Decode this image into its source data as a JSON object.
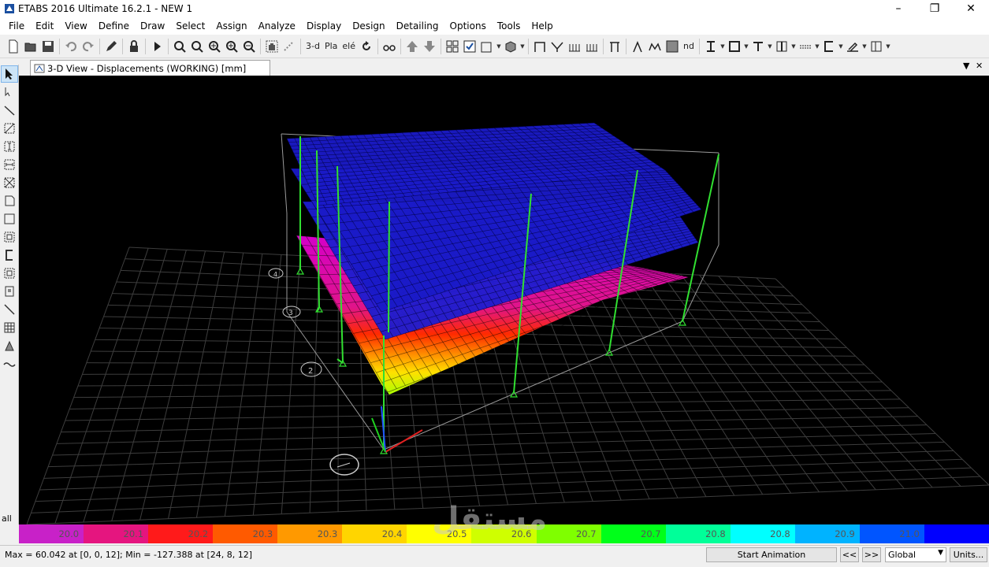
{
  "window": {
    "title": "ETABS 2016 Ultimate 16.2.1 - NEW 1",
    "minimize": "–",
    "maximize": "❐",
    "close": "✕"
  },
  "menu": [
    "File",
    "Edit",
    "View",
    "Define",
    "Draw",
    "Select",
    "Assign",
    "Analyze",
    "Display",
    "Design",
    "Detailing",
    "Options",
    "Tools",
    "Help"
  ],
  "toolbar": {
    "view_3d_label": "3-d",
    "plan_label": "Pla",
    "elev_label": "elé",
    "nd_label": "nd"
  },
  "tab": {
    "label": "3-D View   - Displacements (WORKING)  [mm]",
    "dropdown": "▼",
    "close": "✕"
  },
  "left_tools": {
    "all_label": "all"
  },
  "colorbar": {
    "segments": [
      {
        "label": "20.0",
        "color": "#c821c8"
      },
      {
        "label": "20.1",
        "color": "#e5157f"
      },
      {
        "label": "20.2",
        "color": "#ff1a1a"
      },
      {
        "label": "20.3",
        "color": "#ff5a00"
      },
      {
        "label": "20.3",
        "color": "#ff9900"
      },
      {
        "label": "20.4",
        "color": "#ffd500"
      },
      {
        "label": "20.5",
        "color": "#ffff00"
      },
      {
        "label": "20.6",
        "color": "#cfff00"
      },
      {
        "label": "20.7",
        "color": "#7fff00"
      },
      {
        "label": "20.7",
        "color": "#00ff1a"
      },
      {
        "label": "20.8",
        "color": "#00ff99"
      },
      {
        "label": "20.8",
        "color": "#00ffff"
      },
      {
        "label": "20.9",
        "color": "#00b3ff"
      },
      {
        "label": "21.0",
        "color": "#0055ff"
      },
      {
        "label": "",
        "color": "#0000ff"
      }
    ]
  },
  "status": {
    "text": "Max = 60.042 at [0, 0, 12];  Min = -127.388 at [24, 8, 12]",
    "start_animation": "Start Animation",
    "prev": "<<",
    "next": ">>",
    "coord_system": "Global",
    "units": "Units..."
  },
  "grid_bubbles": [
    "2",
    "3",
    "4"
  ],
  "watermark": "مستقل"
}
